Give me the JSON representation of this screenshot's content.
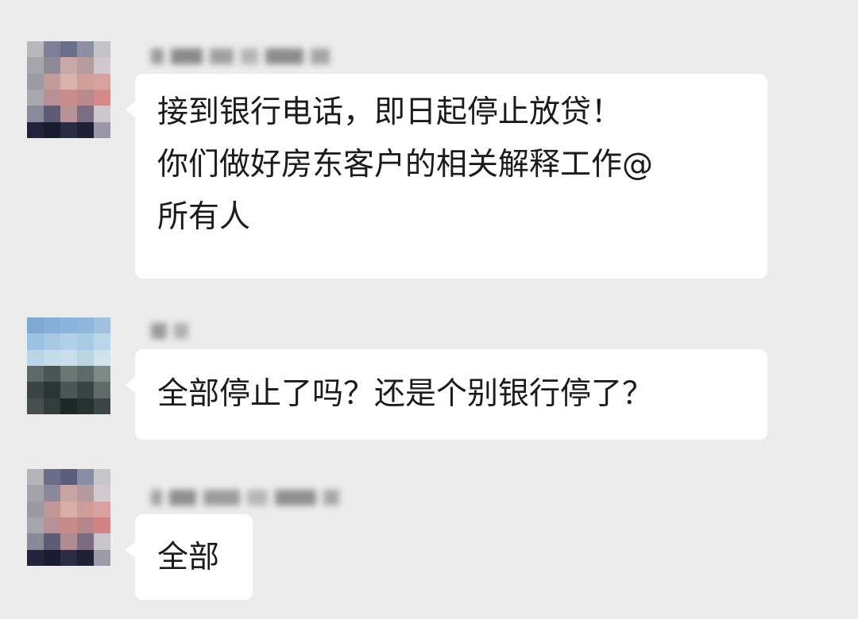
{
  "conversation": {
    "messages": [
      {
        "avatar_icon": "blurred-avatar-icon",
        "sender_name_censored": true,
        "lines": [
          "接到银行电话，即日起停止放贷！",
          "你们做好房东客户的相关解释工作@",
          "所有人"
        ]
      },
      {
        "avatar_icon": "blurred-avatar-icon",
        "sender_name_censored": true,
        "lines": [
          "全部停止了吗？还是个别银行停了？"
        ]
      },
      {
        "avatar_icon": "blurred-avatar-icon",
        "sender_name_censored": true,
        "lines": [
          "全部"
        ]
      }
    ]
  },
  "colors": {
    "background": "#ececec",
    "bubble": "#ffffff",
    "text": "#1b1b1b"
  }
}
